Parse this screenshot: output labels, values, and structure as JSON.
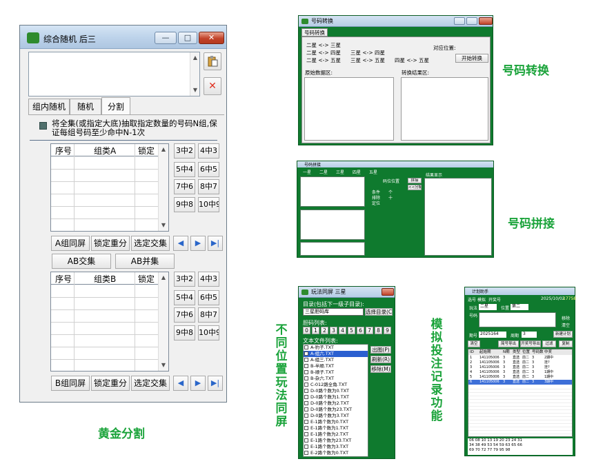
{
  "main_window": {
    "title": "综合随机 后三",
    "cap_min": "—",
    "cap_max": "□",
    "cap_close": "✕",
    "tabs": [
      "组内随机",
      "随机",
      "分割"
    ],
    "description": "将全集(或指定大底)抽取指定数量的号码N组,保证每组号码至少命中N-1次",
    "grid_a_headers": [
      "序号",
      "组类A",
      "锁定"
    ],
    "grid_b_headers": [
      "序号",
      "组类B",
      "锁定"
    ],
    "hit_buttons": [
      "3中2",
      "4中3",
      "5中4",
      "6中5",
      "7中6",
      "8中7",
      "9中8",
      "10中9"
    ],
    "a_row_buttons": [
      "A组同屏",
      "锁定重分",
      "选定交集"
    ],
    "ab_buttons": [
      "AB交集",
      "AB并集"
    ],
    "b_row_buttons": [
      "B组同屏",
      "锁定重分",
      "选定交集"
    ],
    "nav_icons": [
      "◀",
      "▶",
      "▶|"
    ]
  },
  "captions": {
    "golden": "黄金分割",
    "convert": "号码转换",
    "splice": "号码拼接",
    "same_screen": "不同位置玩法同屏",
    "simulate": "模拟投注记录功能"
  },
  "convert_window": {
    "title": "号码转换",
    "tab": "号码转换",
    "options": [
      "二星 <-> 三星",
      "二星 <-> 四星",
      "三星 <-> 四星",
      "二星 <-> 五星",
      "三星 <-> 五星",
      "四星 <-> 五星"
    ],
    "position_label": "对应位置:",
    "start_button": "开始转换",
    "source_label": "原始数据区:",
    "result_label": "转换结果区:"
  },
  "splice_window": {
    "title": "号码拼接",
    "radio_options": [
      "一星",
      "二星",
      "三星",
      "四星",
      "五星"
    ],
    "middle_buttons": [
      "拼接",
      "<<分解"
    ],
    "result_label": "结果显示",
    "position_label": "码位位置",
    "checkbox_labels": [
      "条件",
      "排除",
      "定位"
    ],
    "radio_labels": [
      "个",
      "十"
    ]
  },
  "same_screen_window": {
    "title": "玩法同屏 三星",
    "dir_label": "目录(包括下一级子目录):",
    "dir_value": "三星胆码库",
    "choose_dir": "选择目录(C)",
    "code_list_label": "胆码列表:",
    "code_digits": [
      "0",
      "1",
      "2",
      "3",
      "4",
      "5",
      "6",
      "7",
      "8",
      "9"
    ],
    "file_list_label": "文本文件列表:",
    "files": [
      "A-豹子.TXT",
      "A-组六.TXT",
      "A-组三.TXT",
      "B-半顺.TXT",
      "B-顺子.TXT",
      "B-杂六.TXT",
      "C-012路全角.TXT",
      "D-0路个数为0.TXT",
      "D-0路个数为1.TXT",
      "D-0路个数为2.TXT",
      "D-0路个数为23.TXT",
      "D-0路个数为3.TXT",
      "E-1路个数为0.TXT",
      "E-1路个数为1.TXT",
      "E-1路个数为2.TXT",
      "E-1路个数为23.TXT",
      "E-1路个数为3.TXT",
      "E-2路个数为0.TXT"
    ],
    "side_buttons": [
      "出图(P)",
      "刷新(R)",
      "移除(M)"
    ]
  },
  "simulate_window": {
    "title": "计划助手",
    "tabs": [
      "选号",
      "模拟",
      "开奖号"
    ],
    "date_text": "2025/10/02",
    "time_text": "17758",
    "play_label": "玩法",
    "play_value": "二星",
    "pos_label": "位置",
    "pos_value": "第二",
    "multiplier_label": "倍数",
    "issue_label": "期号",
    "issue_value": "2025164",
    "period_label": "周期",
    "period_value": "3",
    "new_plan": "新建计划",
    "code_label": "号码",
    "side_labels": [
      "移除",
      "清空"
    ],
    "toolbar": [
      "清空",
      "简号导出",
      "开奖号导出",
      "过滤",
      "复制"
    ],
    "columns": [
      "ID",
      "起始期",
      "N期",
      "类型",
      "位置",
      "号码数",
      "中奖"
    ],
    "rows": [
      [
        "1",
        "141105006",
        "3",
        "直选",
        "前二",
        "3",
        "2期中"
      ],
      [
        "2",
        "141105006",
        "3",
        "直选",
        "前二",
        "3",
        "挂?"
      ],
      [
        "3",
        "141105006",
        "3",
        "直选",
        "前二",
        "3",
        "挂?"
      ],
      [
        "4",
        "141105006",
        "3",
        "直选",
        "前二",
        "3",
        "1期中"
      ],
      [
        "5",
        "141105006",
        "3",
        "直选",
        "前二",
        "3",
        "1期中"
      ],
      [
        "6",
        "141105006",
        "3",
        "直选",
        "前二",
        "3",
        "3期中"
      ]
    ],
    "footer_lines": [
      "06 08 10 13 19 20 23 24 31",
      "34 38 49 53 54 59 63 65 66",
      "69 70 72 77 79 95 98"
    ]
  }
}
